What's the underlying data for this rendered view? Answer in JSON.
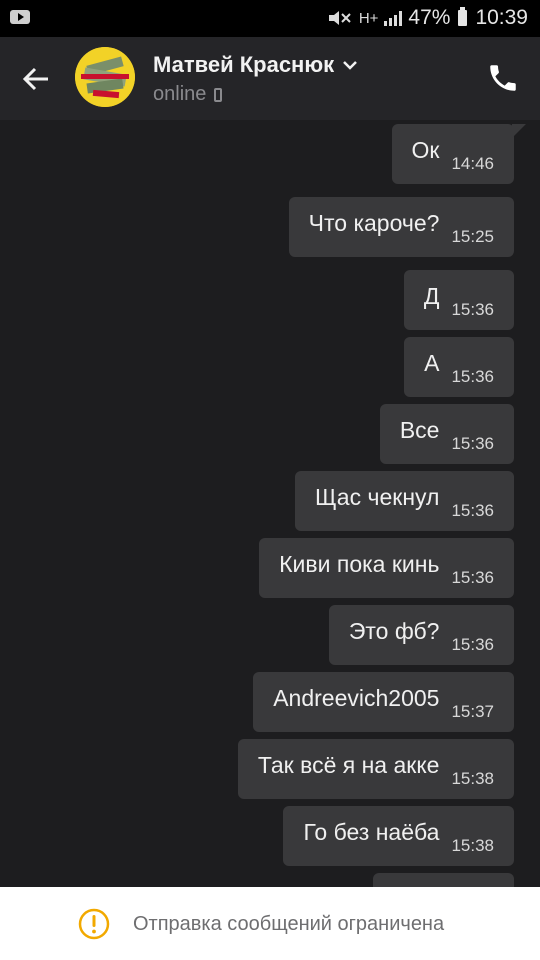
{
  "status_bar": {
    "battery": "47%",
    "time": "10:39",
    "network": "H+"
  },
  "header": {
    "contact_name": "Матвей Краснюк",
    "status": "online"
  },
  "messages": [
    {
      "text": "Ок",
      "time": "14:46"
    },
    {
      "text": "Что кароче?",
      "time": "15:25"
    },
    {
      "text": "Д",
      "time": "15:36"
    },
    {
      "text": "А",
      "time": "15:36"
    },
    {
      "text": "Все",
      "time": "15:36"
    },
    {
      "text": "Щас чекнул",
      "time": "15:36"
    },
    {
      "text": "Киви пока кинь",
      "time": "15:36"
    },
    {
      "text": "Это фб?",
      "time": "15:36"
    },
    {
      "text": "Andreevich2005",
      "time": "15:37"
    },
    {
      "text": "Так всё я на акке",
      "time": "15:38"
    },
    {
      "text": "Го без наёба",
      "time": "15:38"
    }
  ],
  "footer": {
    "notice": "Отправка сообщений ограничена"
  },
  "colors": {
    "background": "#1d1d1f",
    "header": "#252528",
    "bubble": "#39393b",
    "warning": "#f2a900"
  }
}
